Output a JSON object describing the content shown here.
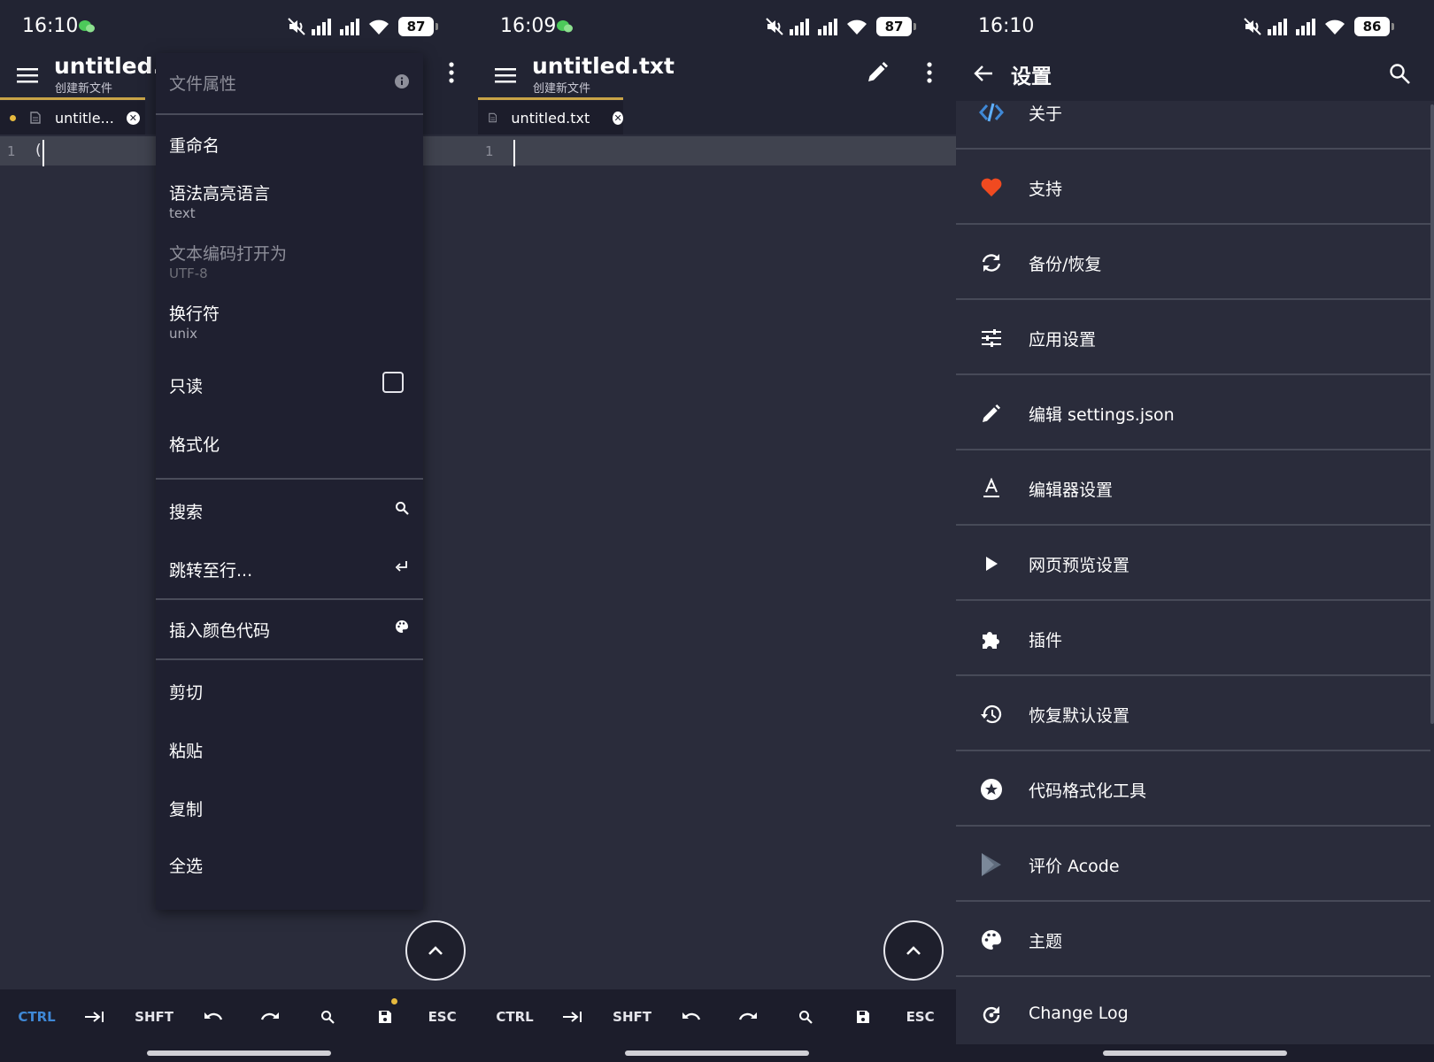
{
  "panels": [
    {
      "status": {
        "time": "16:10",
        "battery": "87"
      },
      "appbar": {
        "title": "untitled.tx",
        "subtitle": "创建新文件"
      },
      "tab": {
        "label": "untitle..."
      },
      "editor": {
        "line_number": "1",
        "content": "("
      },
      "menu": {
        "header": "文件属性",
        "items": {
          "rename": "重命名",
          "syntax": "语法高亮语言",
          "syntax_value": "text",
          "encoding": "文本编码打开为",
          "encoding_value": "UTF-8",
          "line_ending": "换行符",
          "line_ending_value": "unix",
          "readonly": "只读",
          "format": "格式化",
          "search": "搜索",
          "goto": "跳转至行...",
          "color": "插入颜色代码",
          "cut": "剪切",
          "paste": "粘贴",
          "copy": "复制",
          "select_all": "全选"
        }
      },
      "quickbar": {
        "ctrl": "CTRL",
        "shift": "SHFT",
        "esc": "ESC"
      }
    },
    {
      "status": {
        "time": "16:09",
        "battery": "87"
      },
      "appbar": {
        "title": "untitled.txt",
        "subtitle": "创建新文件"
      },
      "tab": {
        "label": "untitled.txt"
      },
      "editor": {
        "line_number": "1"
      },
      "quickbar": {
        "ctrl": "CTRL",
        "shift": "SHFT",
        "esc": "ESC"
      }
    },
    {
      "status": {
        "time": "16:10",
        "battery": "86"
      },
      "title": "设置",
      "items": [
        {
          "label": "关于",
          "icon": "acode-logo-icon"
        },
        {
          "label": "支持",
          "icon": "heart-icon"
        },
        {
          "label": "备份/恢复",
          "icon": "sync-icon"
        },
        {
          "label": "应用设置",
          "icon": "tune-icon"
        },
        {
          "label": "编辑 settings.json",
          "icon": "pencil-icon"
        },
        {
          "label": "编辑器设置",
          "icon": "text-format-icon"
        },
        {
          "label": "网页预览设置",
          "icon": "play-icon"
        },
        {
          "label": "插件",
          "icon": "puzzle-icon"
        },
        {
          "label": "恢复默认设置",
          "icon": "history-icon"
        },
        {
          "label": "代码格式化工具",
          "icon": "star-circle-icon"
        },
        {
          "label": "评价 Acode",
          "icon": "play-store-icon"
        },
        {
          "label": "主题",
          "icon": "palette-icon"
        },
        {
          "label": "Change Log",
          "icon": "changelog-icon"
        }
      ]
    }
  ],
  "colors": {
    "accent": "#c9a447",
    "ctrl_active": "#3f88d6",
    "heart": "#f04a20",
    "background": "#2a2c3b",
    "bar": "#222433"
  }
}
